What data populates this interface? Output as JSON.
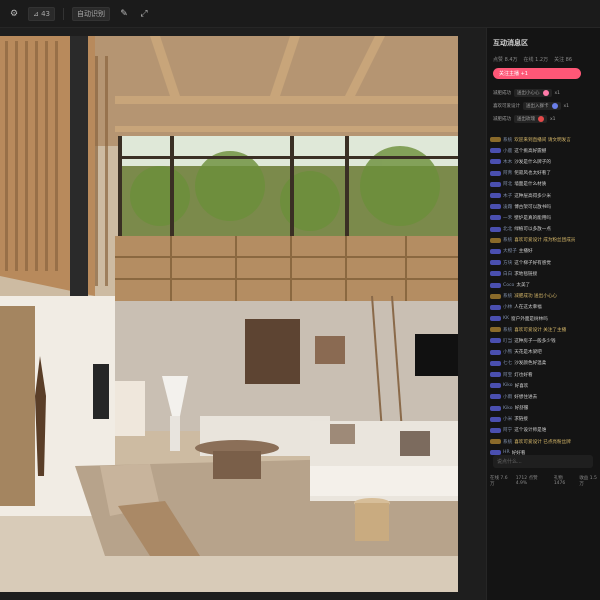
{
  "toolbar": {
    "chip1": "⊿ 43",
    "chip2": "自动识别",
    "icons": [
      "settings-icon",
      "text-size-icon",
      "brush-icon",
      "resize-icon"
    ]
  },
  "panel": {
    "title": "互动消息区",
    "stats": [
      "点赞 8.4万",
      "在线 1.2万",
      "关注 86"
    ],
    "follow_label": "关注主播 +1",
    "gifts": [
      {
        "user": "减肥成功",
        "gift": "送出小心心",
        "count": "x1"
      },
      {
        "user": "喜欢可爱设计",
        "gift": "送出入群卡",
        "count": "x1"
      },
      {
        "user": "减肥成功",
        "gift": "送出玫瑰",
        "count": "x1"
      }
    ],
    "chat": [
      {
        "badge": "gold",
        "user": "系统",
        "msg": "欢迎来到直播间 请文明发言",
        "color": "gold"
      },
      {
        "badge": "blue",
        "user": "小鹿",
        "msg": "这个挑高好震撼",
        "color": ""
      },
      {
        "badge": "blue",
        "user": "木木",
        "msg": "沙发是什么牌子的",
        "color": ""
      },
      {
        "badge": "blue",
        "user": "阿青",
        "msg": "侘寂风也太好看了",
        "color": ""
      },
      {
        "badge": "blue",
        "user": "阿北",
        "msg": "墙面是什么材质",
        "color": ""
      },
      {
        "badge": "blue",
        "user": "木子",
        "msg": "这种层高得多少米",
        "color": ""
      },
      {
        "badge": "blue",
        "user": "凌霜",
        "msg": "博古架可以放书吗",
        "color": ""
      },
      {
        "badge": "blue",
        "user": "一禾",
        "msg": "壁炉是真的能用吗",
        "color": ""
      },
      {
        "badge": "blue",
        "user": "北北",
        "msg": "绿植可以多放一点",
        "color": ""
      },
      {
        "badge": "gold",
        "user": "系统",
        "msg": "喜欢可爱设计 成为粉丝团成员",
        "color": "gold"
      },
      {
        "badge": "blue",
        "user": "大橙子",
        "msg": "主播好",
        "color": ""
      },
      {
        "badge": "blue",
        "user": "方块",
        "msg": "这个梯子好有感觉",
        "color": ""
      },
      {
        "badge": "blue",
        "user": "白白",
        "msg": "求地毯链接",
        "color": ""
      },
      {
        "badge": "blue",
        "user": "Coco",
        "msg": "太美了",
        "color": ""
      },
      {
        "badge": "gold",
        "user": "系统",
        "msg": "减肥成功 送出小心心",
        "color": "gold"
      },
      {
        "badge": "blue",
        "user": "小林",
        "msg": "人在这太幸福",
        "color": ""
      },
      {
        "badge": "blue",
        "user": "KK",
        "msg": "窗户外面是树林吗",
        "color": ""
      },
      {
        "badge": "gold",
        "user": "系统",
        "msg": "喜欢可爱设计 关注了主播",
        "color": "gold"
      },
      {
        "badge": "blue",
        "user": "叮当",
        "msg": "这种房子一般多少钱",
        "color": ""
      },
      {
        "badge": "blue",
        "user": "小熊",
        "msg": "天花是木梁吧",
        "color": ""
      },
      {
        "badge": "blue",
        "user": "七七",
        "msg": "沙发颜色好温柔",
        "color": ""
      },
      {
        "badge": "blue",
        "user": "阿宝",
        "msg": "灯也好看",
        "color": ""
      },
      {
        "badge": "blue",
        "user": "Kiko",
        "msg": "好喜欢",
        "color": ""
      },
      {
        "badge": "blue",
        "user": "小雨",
        "msg": "好想住进去",
        "color": ""
      },
      {
        "badge": "blue",
        "user": "Kiko",
        "msg": "好舒服",
        "color": ""
      },
      {
        "badge": "blue",
        "user": "小米",
        "msg": "求链接",
        "color": ""
      },
      {
        "badge": "blue",
        "user": "阿宁",
        "msg": "这个设计师是谁",
        "color": ""
      },
      {
        "badge": "gold",
        "user": "系统",
        "msg": "喜欢可爱设计 已点亮粉丝牌",
        "color": "gold"
      },
      {
        "badge": "blue",
        "user": "HR",
        "msg": "好好看",
        "color": ""
      }
    ],
    "input_placeholder": "说点什么...",
    "footer": [
      "在线 7.6万",
      "1712 点赞 4.9%",
      "礼物 1476",
      "收益 1.5万"
    ]
  }
}
